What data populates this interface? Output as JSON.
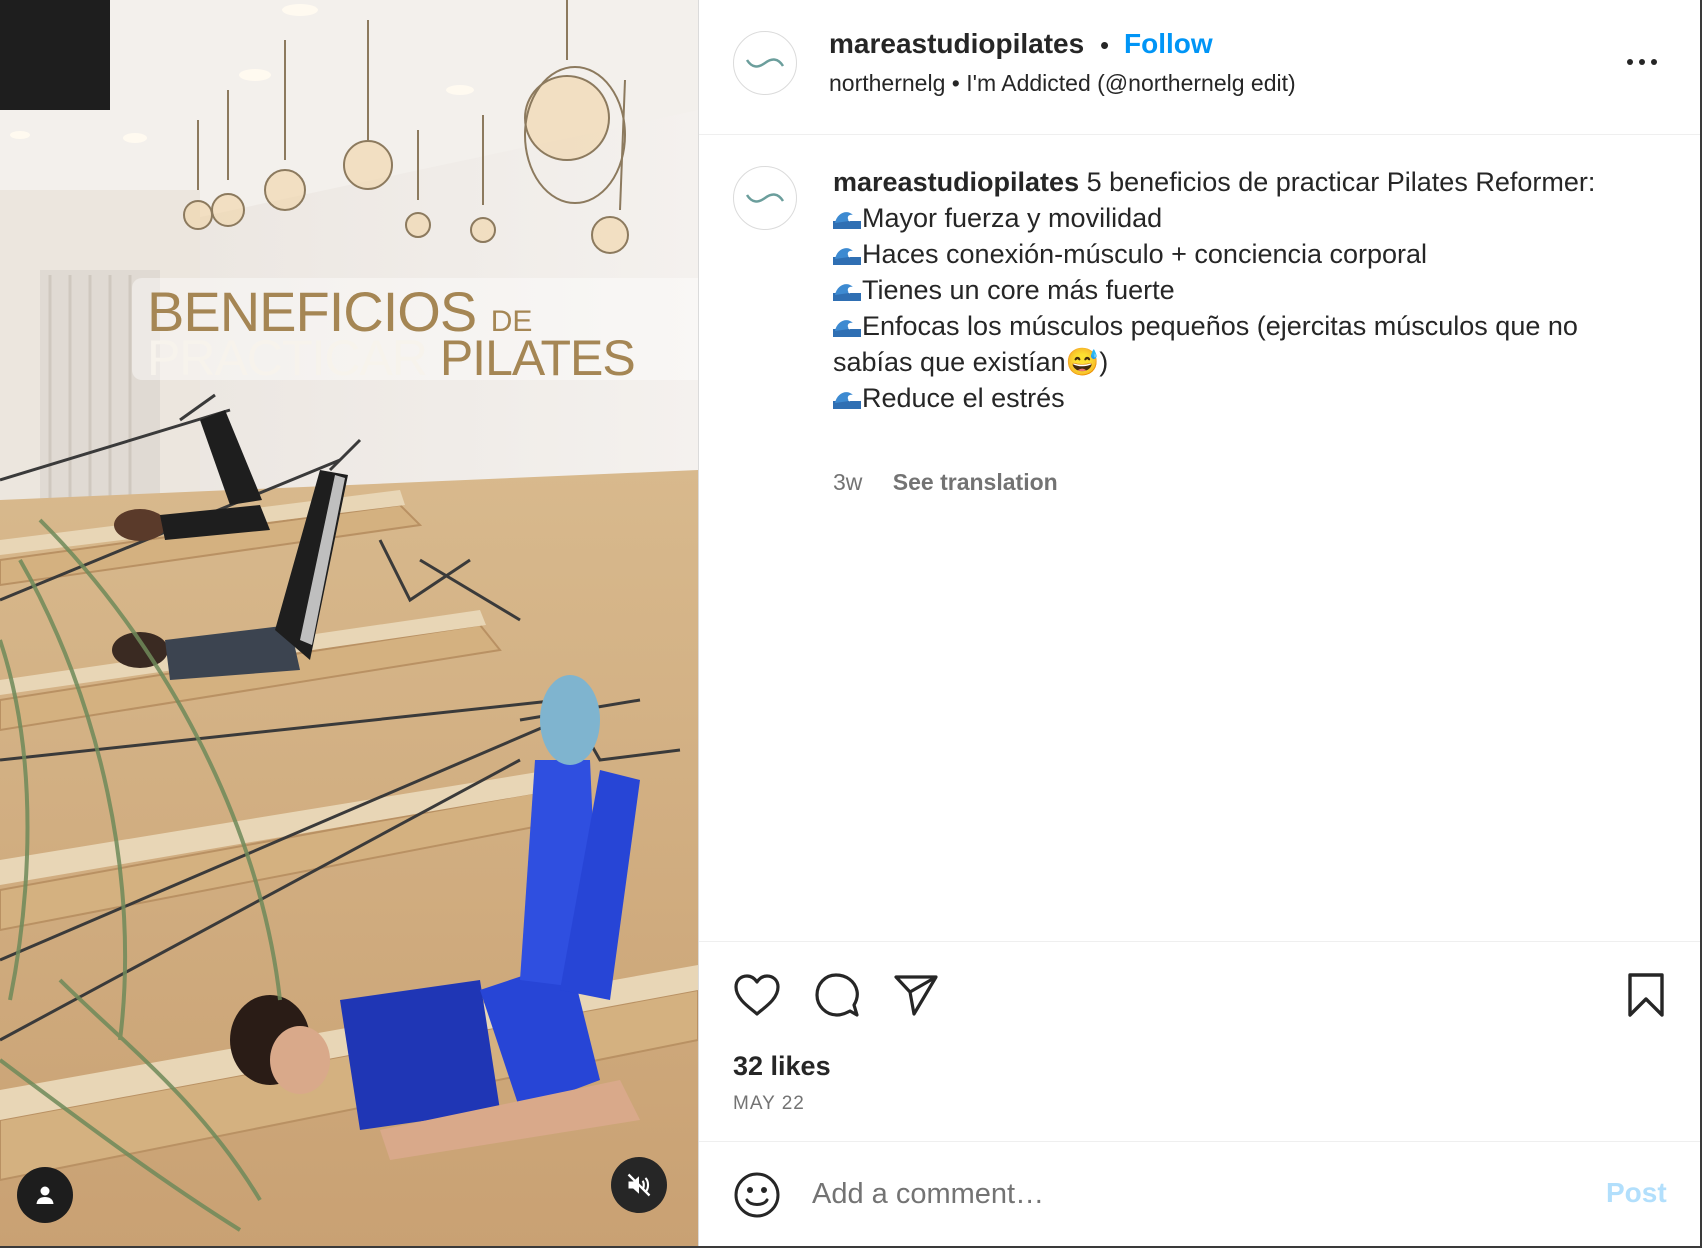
{
  "media": {
    "overlay_line1_big": "BENEFICIOS",
    "overlay_line1_small": "DE",
    "overlay_line2_white": "PRACTICAR",
    "overlay_line2_gold": "PILATES",
    "tag_icon": "person-tag-icon",
    "mute_icon": "muted-speaker-icon"
  },
  "header": {
    "username": "mareastudiopilates",
    "separator": "•",
    "follow_label": "Follow",
    "audio_line": "northernelg • I'm Addicted (@northernelg edit)",
    "more_icon": "more-options-icon"
  },
  "caption": {
    "username": "mareastudiopilates",
    "intro": "5 beneficios de practicar Pilates Reformer:",
    "points": [
      "Mayor fuerza y movilidad",
      "Haces conexión-músculo + conciencia corporal",
      "Tienes un core más fuerte",
      "Enfocas los músculos pequeños (ejercitas músculos que no sabías que existían😅)",
      "Reduce el estrés"
    ],
    "time": "3w",
    "translate_label": "See translation"
  },
  "actions": {
    "like_icon": "heart-icon",
    "comment_icon": "comment-bubble-icon",
    "share_icon": "paper-plane-icon",
    "save_icon": "bookmark-icon",
    "likes": "32 likes",
    "date": "MAY 22"
  },
  "comment": {
    "emoji_icon": "smiley-icon",
    "placeholder": "Add a comment…",
    "post_label": "Post",
    "value": ""
  },
  "colors": {
    "link_blue": "#0095f6",
    "post_disabled": "#b2dffc",
    "text_primary": "#262626",
    "text_secondary": "#737373",
    "logo_teal": "#6b9e9c",
    "overlay_gold": "#a58654"
  }
}
